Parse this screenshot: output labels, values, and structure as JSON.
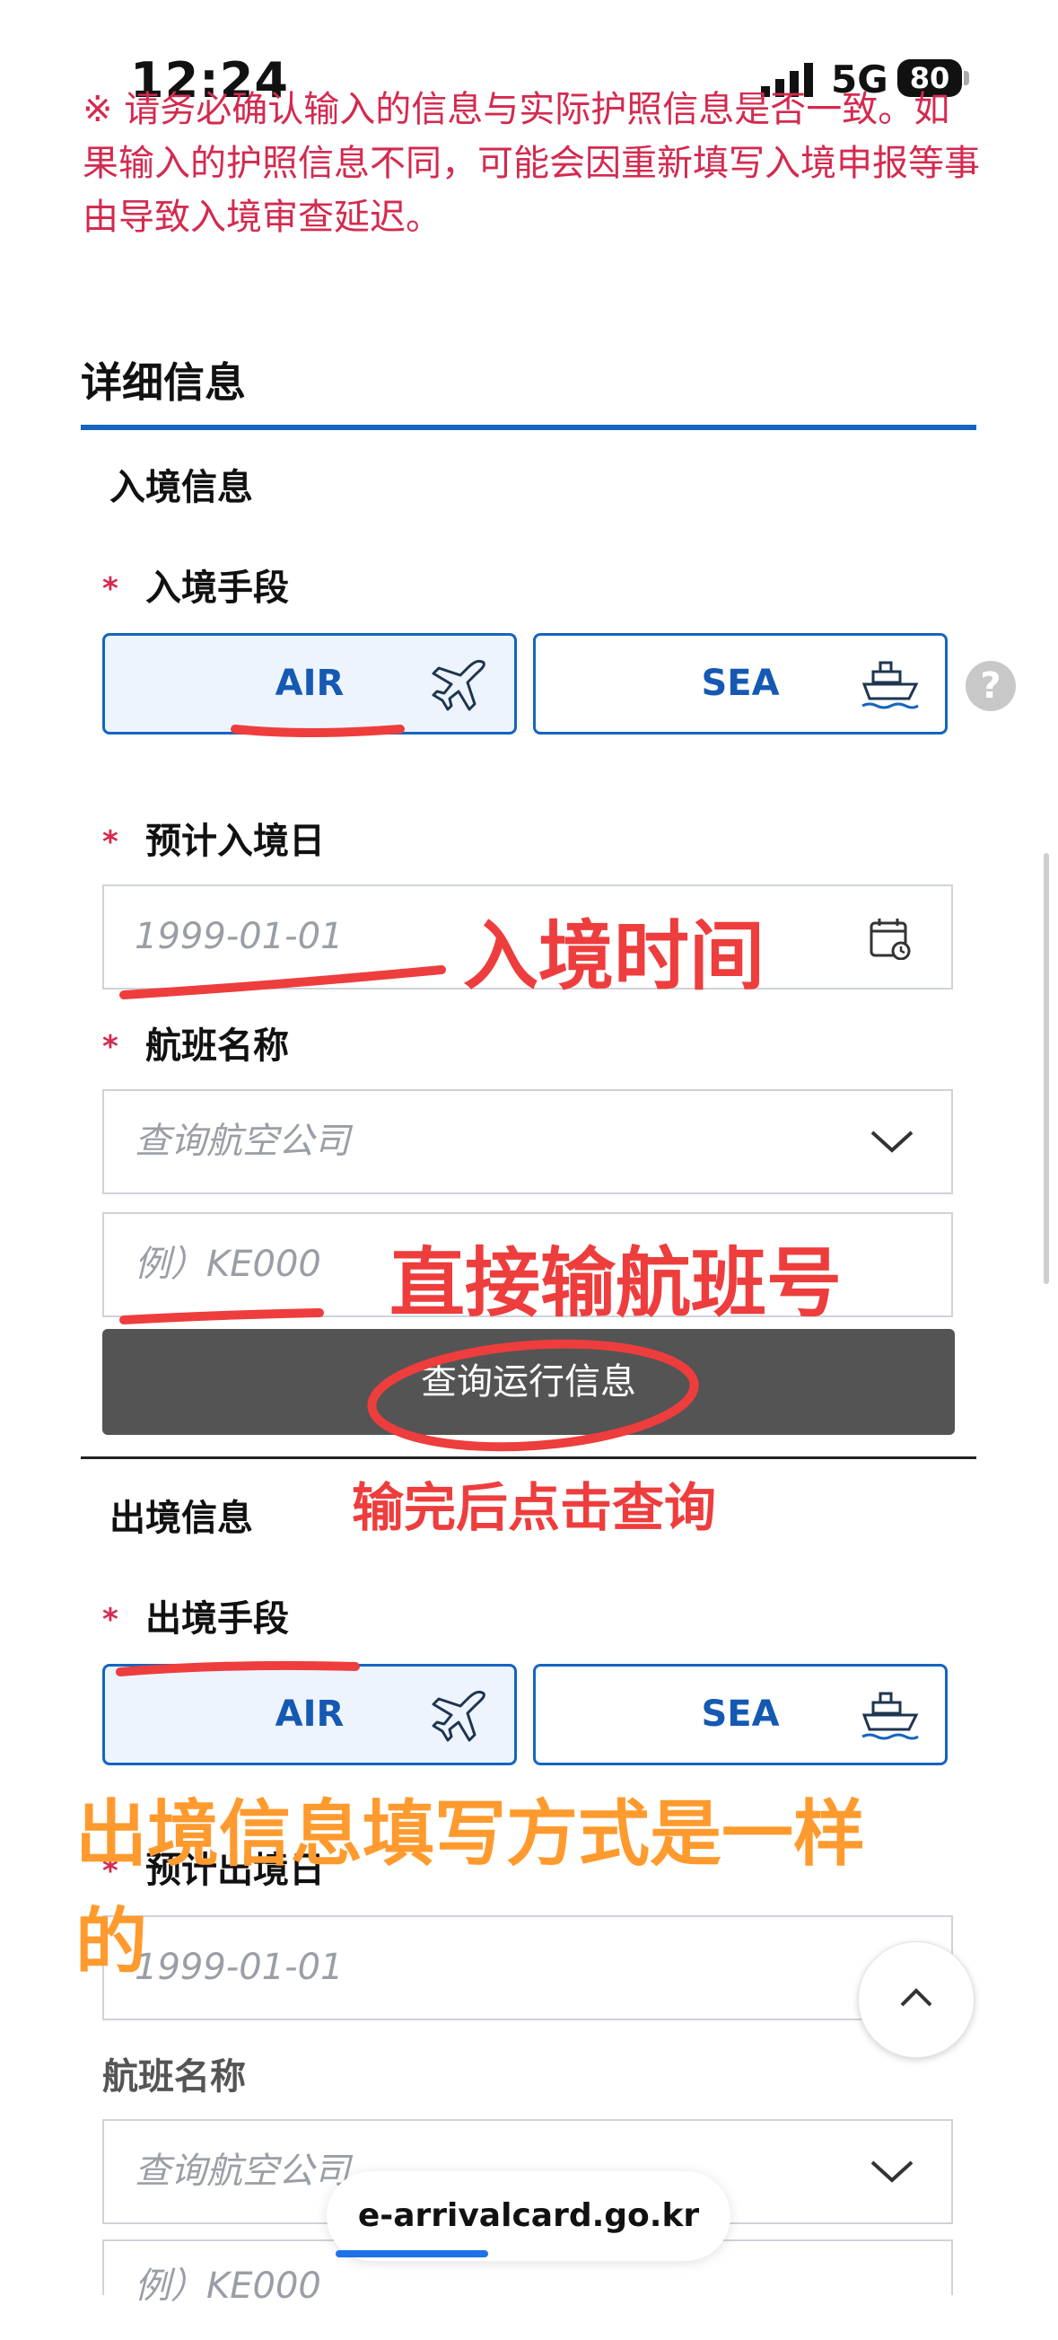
{
  "status_bar": {
    "time": "12:24",
    "network": "5G",
    "battery": "80"
  },
  "notice": "※ 请务必确认输入的信息与实际护照信息是否一致。如果输入的护照信息不同，可能会因重新填写入境申报等事由导致入境审查延迟。",
  "section": {
    "title": "详细信息"
  },
  "entry": {
    "title": "入境信息",
    "mode_label": "入境手段",
    "modes": [
      "AIR",
      "SEA"
    ],
    "date_label": "预计入境日",
    "date_placeholder": "1999-01-01",
    "flight_label": "航班名称",
    "airline_placeholder": "查询航空公司",
    "flight_no_placeholder": "例）KE000",
    "query_button": "查询运行信息"
  },
  "exit": {
    "title": "出境信息",
    "mode_label": "出境手段",
    "modes": [
      "AIR",
      "SEA"
    ],
    "date_label": "预计出境日",
    "date_placeholder": "1999-01-01",
    "flight_label": "航班名称",
    "airline_placeholder": "查询航空公司",
    "flight_no_placeholder": "例）KE000"
  },
  "required_mark": "*",
  "help": "?",
  "url": "e-arrivalcard.go.kr",
  "annotations": {
    "entry_time": "入境时间",
    "flight_number": "直接输航班号",
    "click_query": "输完后点击查询",
    "exit_same_line1": "出境信息填写方式是一样",
    "exit_same_line2": "的"
  },
  "colors": {
    "accent": "#1565c0",
    "required": "#d42a4f",
    "annotation_red": "#ee3d3d",
    "annotation_orange": "#ff9a2e"
  }
}
